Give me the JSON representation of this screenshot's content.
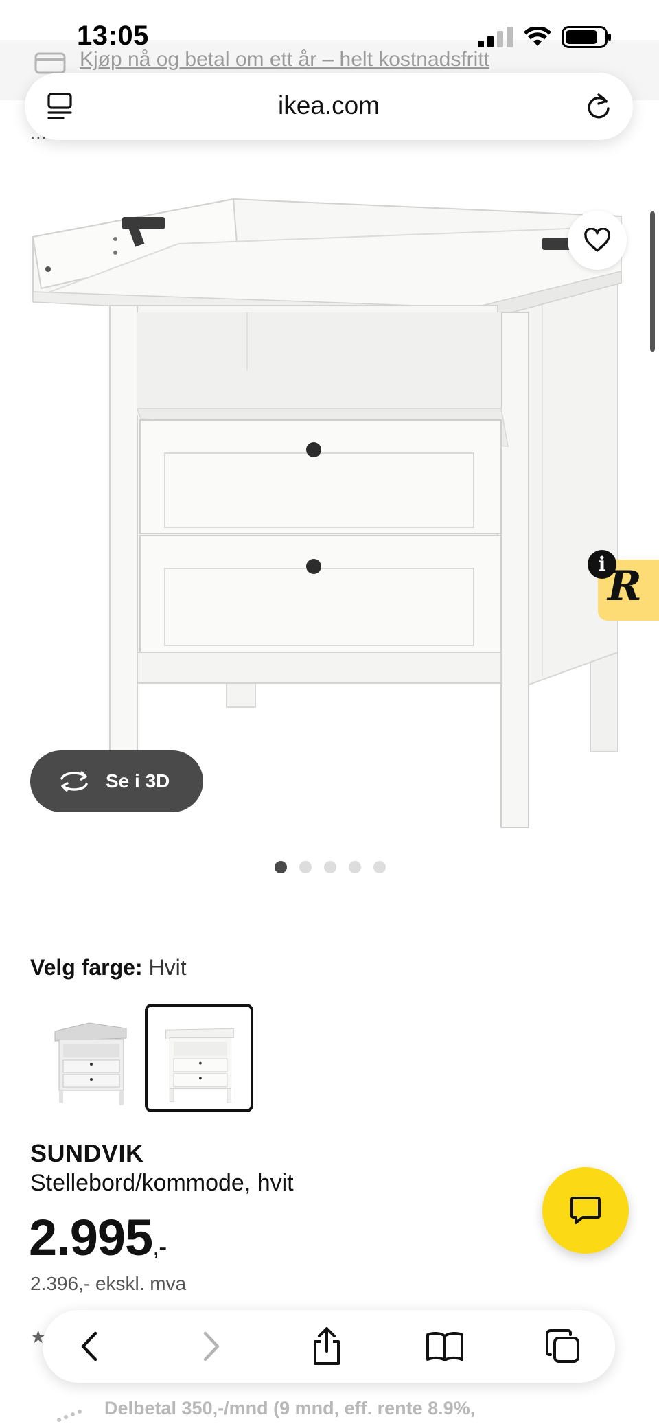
{
  "status_bar": {
    "time": "13:05"
  },
  "promo_banner": {
    "text": "Kjøp nå og betal om ett år – helt kostnadsfritt"
  },
  "breadcrumb": {
    "text": "..."
  },
  "browser": {
    "url": "ikea.com"
  },
  "gallery": {
    "see_3d_label": "Se i 3D",
    "image_count": 5,
    "active_index": 0
  },
  "color_picker": {
    "label": "Velg farge:",
    "selected": "Hvit",
    "swatches": [
      {
        "name": "grey-white-variant",
        "selected": false
      },
      {
        "name": "white-variant",
        "selected": true
      }
    ]
  },
  "product": {
    "brand": "SUNDVIK",
    "description": "Stellebord/kommode, hvit",
    "price_main": "2.995",
    "price_suffix": ",-",
    "price_ex_vat": "2.396,- ekskl. mva"
  },
  "financing": {
    "text": "Delbetal 350,-/mnd (9 mnd, eff. rente 8.9%,"
  },
  "badge": {
    "letter": "R",
    "info": "i"
  },
  "colors": {
    "accent_yellow": "#fbd914",
    "badge_yellow": "#fddc75",
    "dark_button": "#4a4a4a"
  }
}
